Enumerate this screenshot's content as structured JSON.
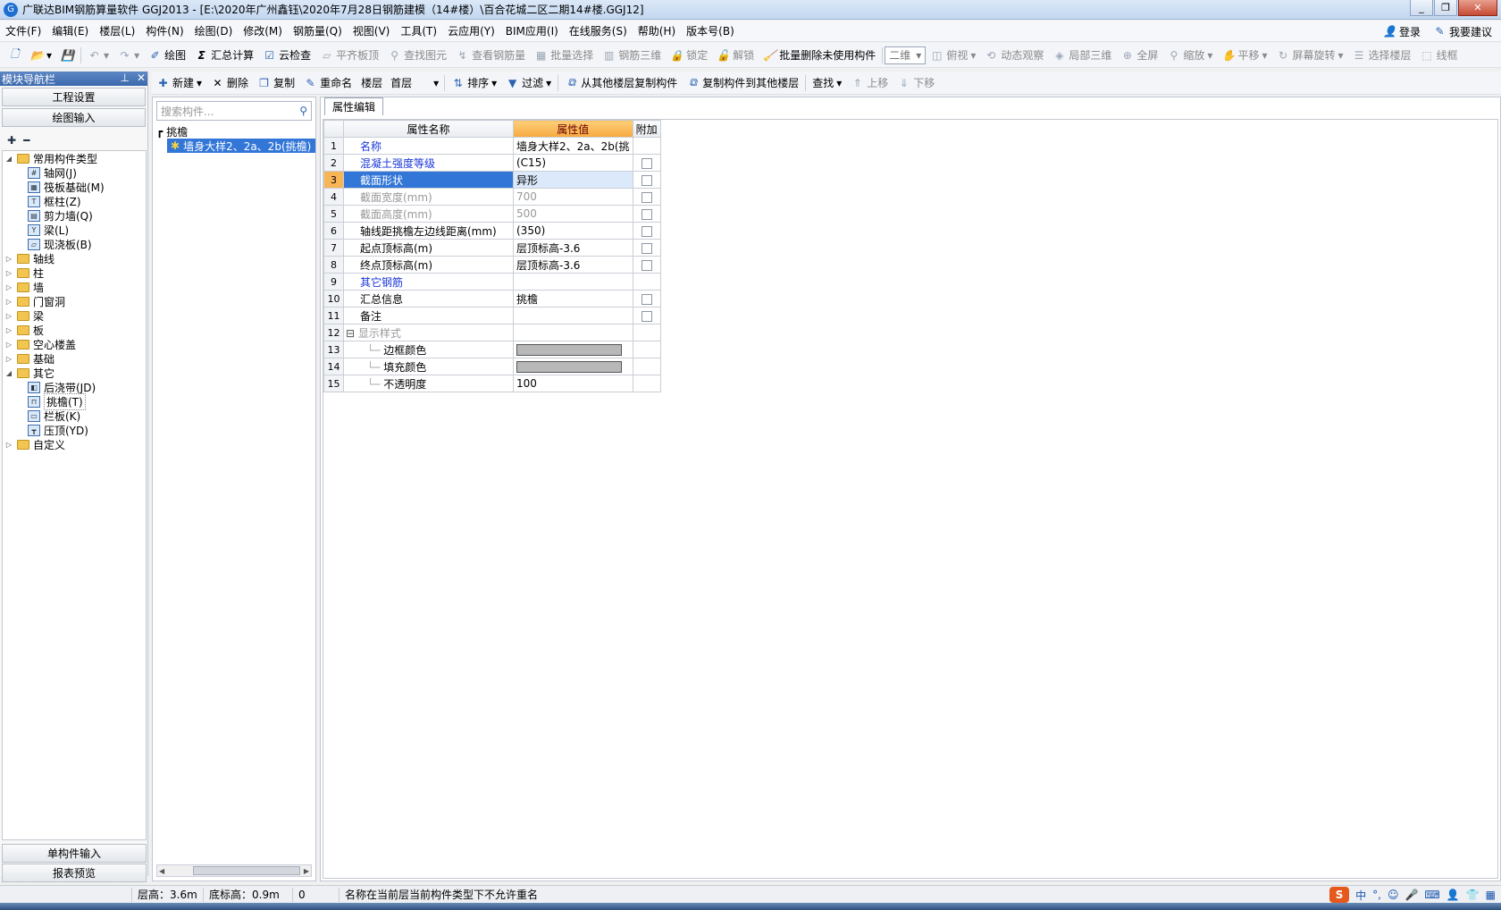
{
  "window": {
    "title": "广联达BIM钢筋算量软件 GGJ2013 - [E:\\2020年广州鑫钰\\2020年7月28日钢筋建模（14#楼）\\百合花城二区二期14#楼.GGJ12]"
  },
  "menu": [
    "文件(F)",
    "编辑(E)",
    "楼层(L)",
    "构件(N)",
    "绘图(D)",
    "修改(M)",
    "钢筋量(Q)",
    "视图(V)",
    "工具(T)",
    "云应用(Y)",
    "BIM应用(I)",
    "在线服务(S)",
    "帮助(H)",
    "版本号(B)"
  ],
  "menu_right": {
    "login": "登录",
    "suggest": "我要建议"
  },
  "toolbar1": {
    "draw": "绘图",
    "sum": "汇总计算",
    "cloud_check": "云检查",
    "flat_top": "平齐板顶",
    "find_elem": "查找图元",
    "view_rebar": "查看钢筋量",
    "batch_select": "批量选择",
    "rebar_3d": "钢筋三维",
    "lock": "锁定",
    "unlock": "解锁",
    "batch_delete": "批量删除未使用构件",
    "view_mode": "二维",
    "top_view": "俯视",
    "dynamic": "动态观察",
    "local_3d": "局部三维",
    "fullscreen": "全屏",
    "zoom": "缩放",
    "pan": "平移",
    "rotate": "屏幕旋转",
    "select_floor": "选择楼层",
    "wireframe": "线框"
  },
  "nav": {
    "header": "模块导航栏",
    "btn_project": "工程设置",
    "btn_draw": "绘图输入",
    "btn_single": "单构件输入",
    "btn_report": "报表预览",
    "tree": [
      {
        "label": "常用构件类型",
        "level": 0,
        "type": "folder",
        "exp": "◢"
      },
      {
        "label": "轴网(J)",
        "level": 1,
        "type": "comp",
        "icon": "#"
      },
      {
        "label": "筏板基础(M)",
        "level": 1,
        "type": "comp",
        "icon": "▦"
      },
      {
        "label": "框柱(Z)",
        "level": 1,
        "type": "comp",
        "icon": "T"
      },
      {
        "label": "剪力墙(Q)",
        "level": 1,
        "type": "comp",
        "icon": "▤"
      },
      {
        "label": "梁(L)",
        "level": 1,
        "type": "comp",
        "icon": "Y"
      },
      {
        "label": "现浇板(B)",
        "level": 1,
        "type": "comp",
        "icon": "▱"
      },
      {
        "label": "轴线",
        "level": 0,
        "type": "folder",
        "exp": "▷"
      },
      {
        "label": "柱",
        "level": 0,
        "type": "folder",
        "exp": "▷"
      },
      {
        "label": "墙",
        "level": 0,
        "type": "folder",
        "exp": "▷"
      },
      {
        "label": "门窗洞",
        "level": 0,
        "type": "folder",
        "exp": "▷"
      },
      {
        "label": "梁",
        "level": 0,
        "type": "folder",
        "exp": "▷"
      },
      {
        "label": "板",
        "level": 0,
        "type": "folder",
        "exp": "▷"
      },
      {
        "label": "空心楼盖",
        "level": 0,
        "type": "folder",
        "exp": "▷"
      },
      {
        "label": "基础",
        "level": 0,
        "type": "folder",
        "exp": "▷"
      },
      {
        "label": "其它",
        "level": 0,
        "type": "folder",
        "exp": "◢"
      },
      {
        "label": "后浇带(JD)",
        "level": 1,
        "type": "comp",
        "icon": "◧"
      },
      {
        "label": "挑檐(T)",
        "level": 1,
        "type": "comp",
        "icon": "⊓"
      },
      {
        "label": "栏板(K)",
        "level": 1,
        "type": "comp",
        "icon": "▭"
      },
      {
        "label": "压顶(YD)",
        "level": 1,
        "type": "comp",
        "icon": "┳"
      },
      {
        "label": "自定义",
        "level": 0,
        "type": "folder",
        "exp": "▷"
      }
    ]
  },
  "toolbar2": {
    "new": "新建",
    "delete": "删除",
    "copy": "复制",
    "rename": "重命名",
    "floor_label": "楼层",
    "floor_value": "首层",
    "sort": "排序",
    "filter": "过滤",
    "copy_from": "从其他楼层复制构件",
    "copy_to": "复制构件到其他楼层",
    "find": "查找",
    "move_up": "上移",
    "move_down": "下移"
  },
  "list": {
    "search_placeholder": "搜索构件...",
    "group": "挑檐",
    "item": "墙身大样2、2a、2b(挑檐)"
  },
  "prop": {
    "tab": "属性编辑",
    "col_name": "属性名称",
    "col_value": "属性值",
    "col_add": "附加",
    "rows": [
      {
        "n": "1",
        "name": "名称",
        "value": "墙身大样2、2a、2b(挑",
        "style": "blue",
        "cb": false
      },
      {
        "n": "2",
        "name": "混凝土强度等级",
        "value": "(C15)",
        "style": "blue",
        "cb": true
      },
      {
        "n": "3",
        "name": "截面形状",
        "value": "异形",
        "style": "hl",
        "cb": true
      },
      {
        "n": "4",
        "name": "截面宽度(mm)",
        "value": "700",
        "style": "grey",
        "cb": true
      },
      {
        "n": "5",
        "name": "截面高度(mm)",
        "value": "500",
        "style": "grey",
        "cb": true
      },
      {
        "n": "6",
        "name": "轴线距挑檐左边线距离(mm)",
        "value": "(350)",
        "style": "",
        "cb": true
      },
      {
        "n": "7",
        "name": "起点顶标高(m)",
        "value": "层顶标高-3.6",
        "style": "",
        "cb": true
      },
      {
        "n": "8",
        "name": "终点顶标高(m)",
        "value": "层顶标高-3.6",
        "style": "",
        "cb": true
      },
      {
        "n": "9",
        "name": "其它钢筋",
        "value": "",
        "style": "blue",
        "cb": false
      },
      {
        "n": "10",
        "name": "汇总信息",
        "value": "挑檐",
        "style": "",
        "cb": true
      },
      {
        "n": "11",
        "name": "备注",
        "value": "",
        "style": "",
        "cb": true
      },
      {
        "n": "12",
        "name": "显示样式",
        "value": "",
        "style": "grey",
        "cb": false,
        "group": true
      },
      {
        "n": "13",
        "name": "边框颜色",
        "value": "",
        "style": "",
        "cb": false,
        "child": true,
        "swatch": true
      },
      {
        "n": "14",
        "name": "填充颜色",
        "value": "",
        "style": "",
        "cb": false,
        "child": true,
        "swatch": true
      },
      {
        "n": "15",
        "name": "不透明度",
        "value": "100",
        "style": "",
        "cb": false,
        "child": true
      }
    ]
  },
  "status": {
    "floor_height": "层高：3.6m",
    "base_height": "底标高：0.9m",
    "zero": "0",
    "message": "名称在当前层当前构件类型下不允许重名"
  },
  "tray": {
    "ime": "中"
  }
}
